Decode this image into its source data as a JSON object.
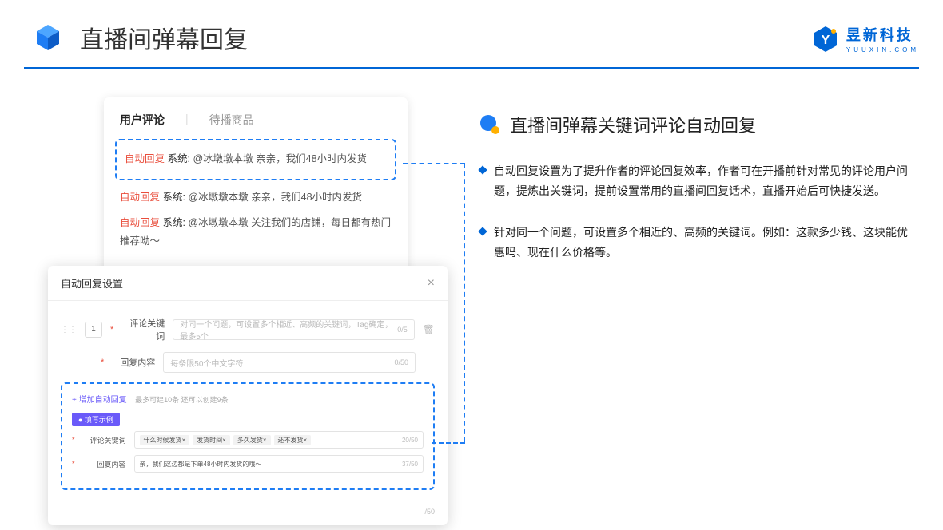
{
  "header": {
    "title": "直播间弹幕回复",
    "brand_name": "昱新科技",
    "brand_url": "YUUXIN.COM"
  },
  "comments_panel": {
    "tabs": {
      "active": "用户评论",
      "inactive": "待播商品"
    },
    "lines": {
      "l1_ar": "自动回复",
      "l1_sys": "系统:",
      "l1_txt": "@冰墩墩本墩 亲亲，我们48小时内发货",
      "l2_ar": "自动回复",
      "l2_sys": "系统:",
      "l2_txt": "@冰墩墩本墩 亲亲，我们48小时内发货",
      "l3_ar": "自动回复",
      "l3_sys": "系统:",
      "l3_txt": "@冰墩墩本墩 关注我们的店铺，每日都有热门推荐呦～"
    }
  },
  "settings_panel": {
    "title": "自动回复设置",
    "num": "1",
    "labels": {
      "keyword": "评论关键词",
      "content": "回复内容"
    },
    "keyword_ph": "对同一个问题，可设置多个相近、高频的关键词，Tag确定，最多5个",
    "keyword_cnt": "0/5",
    "content_ph": "每条限50个中文字符",
    "content_cnt": "0/50",
    "add_link": "+ 增加自动回复",
    "add_hint": "最多可建10条 还可以创建9条",
    "example_badge": "● 填写示例",
    "example": {
      "kw_label": "评论关键词",
      "tags": [
        "什么时候发货×",
        "发货时间×",
        "多久发货×",
        "还不发货×"
      ],
      "kw_cnt": "20/50",
      "ct_label": "回复内容",
      "ct_val": "亲，我们这边都是下单48小时内发货的哦～",
      "ct_cnt": "37/50"
    },
    "bottom_cnt": "/50"
  },
  "right": {
    "section_title": "直播间弹幕关键词评论自动回复",
    "bullets": {
      "b1": "自动回复设置为了提升作者的评论回复效率，作者可在开播前针对常见的评论用户问题，提炼出关键词，提前设置常用的直播间回复话术，直播开始后可快捷发送。",
      "b2": "针对同一个问题，可设置多个相近的、高频的关键词。例如：这款多少钱、这块能优惠吗、现在什么价格等。"
    }
  }
}
